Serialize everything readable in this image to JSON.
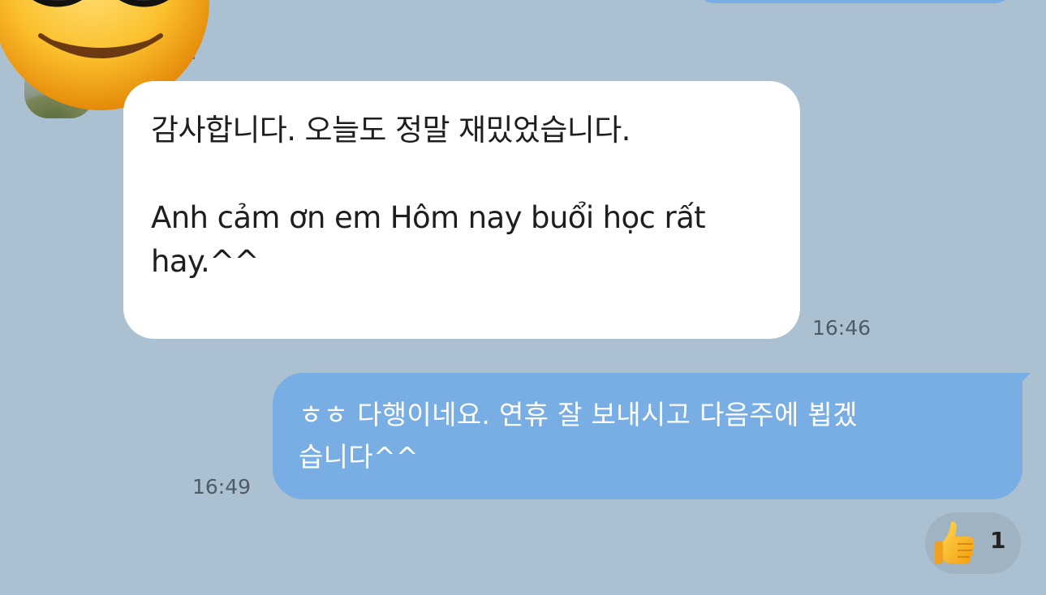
{
  "conversation": {
    "incoming": {
      "line1": "감사합니다. 오늘도 정말 재밌었습니다.",
      "line2": "Anh cảm ơn em Hôm nay buổi học rất",
      "line3": "hay.^^",
      "time": "16:46"
    },
    "outgoing": {
      "line1": "ㅎㅎ 다행이네요. 연휴 잘 보내시고 다음주에 뵙겠",
      "line2": "습니다^^",
      "time": "16:49",
      "reaction": {
        "icon": "thumbs-up-icon",
        "count": "1"
      }
    }
  },
  "colors": {
    "background": "#abc1d1",
    "incoming_bubble": "#ffffff",
    "outgoing_bubble": "#78aee3",
    "reaction_pill": "#9fb3c3"
  }
}
